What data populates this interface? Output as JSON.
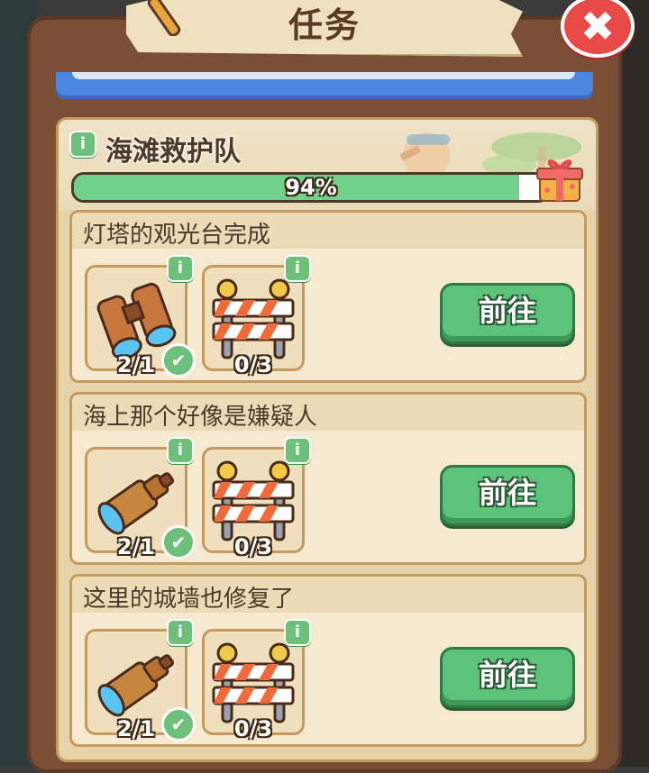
{
  "window": {
    "title": "任务",
    "close_glyph": "✖"
  },
  "quest_group": {
    "title": "海滩救护队",
    "info_glyph": "i",
    "progress": {
      "percent": 0.94,
      "label": "94%"
    },
    "reward_icon": "gift-box-icon"
  },
  "tasks": [
    {
      "title": "灯塔的观光台完成",
      "items": [
        {
          "icon": "binoculars-icon",
          "count": "2/1",
          "complete": true
        },
        {
          "icon": "road-barrier-icon",
          "count": "0/3",
          "complete": false
        }
      ],
      "button": "前往"
    },
    {
      "title": "海上那个好像是嫌疑人",
      "items": [
        {
          "icon": "telescope-icon",
          "count": "2/1",
          "complete": true
        },
        {
          "icon": "road-barrier-icon",
          "count": "0/3",
          "complete": false
        }
      ],
      "button": "前往"
    },
    {
      "title": "这里的城墙也修复了",
      "items": [
        {
          "icon": "telescope-icon",
          "count": "2/1",
          "complete": true
        },
        {
          "icon": "road-barrier-icon",
          "count": "0/3",
          "complete": false
        }
      ],
      "button": "前往"
    }
  ],
  "colors": {
    "frame": "#7a4f36",
    "progress_fill": "#6fd18a",
    "button": "#5cc47a",
    "close": "#e84a47"
  }
}
